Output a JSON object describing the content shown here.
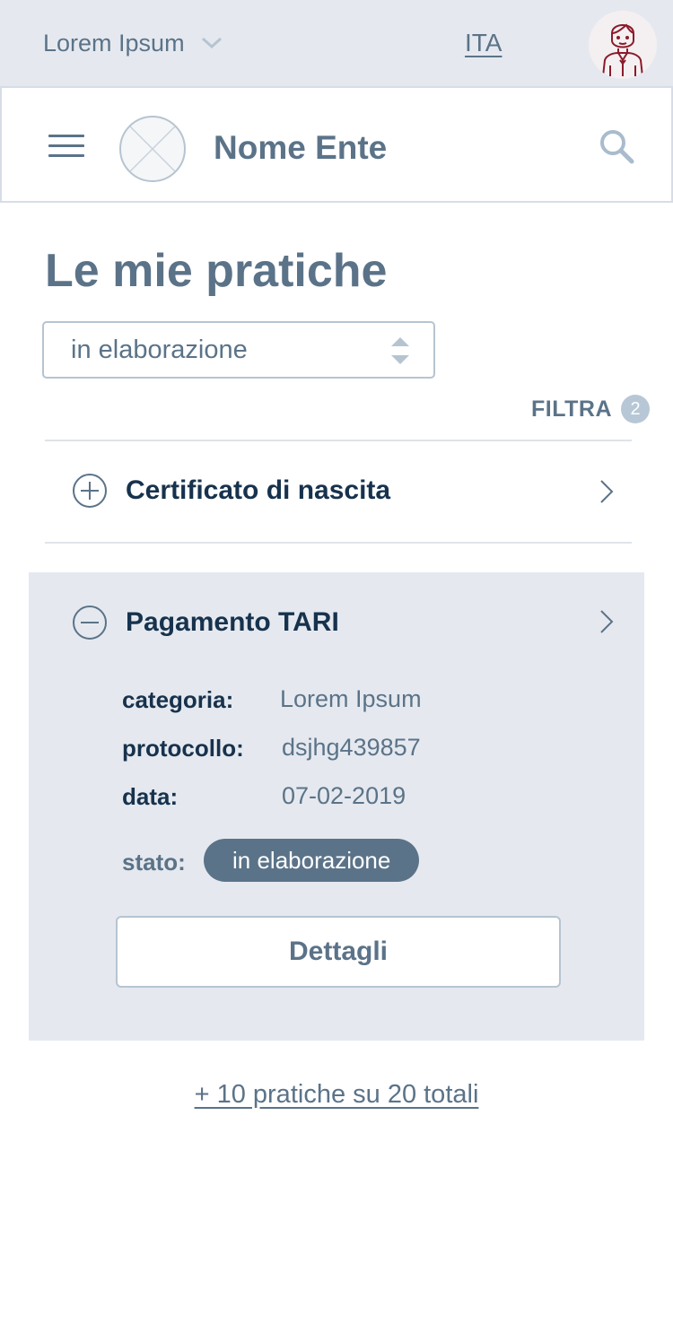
{
  "top_bar": {
    "org_label": "Lorem Ipsum",
    "language": "ITA"
  },
  "header": {
    "entity_name": "Nome Ente"
  },
  "page": {
    "title": "Le mie pratiche",
    "status_filter_value": "in elaborazione",
    "filter_label": "FILTRA",
    "filter_count": "2"
  },
  "items": [
    {
      "title": "Certificato di nascita"
    },
    {
      "title": "Pagamento TARI",
      "category_label": "categoria:",
      "category_value": "Lorem Ipsum",
      "protocol_label": "protocollo:",
      "protocol_value": "dsjhg439857",
      "date_label": "data:",
      "date_value": "07-02-2019",
      "status_label": "stato:",
      "status_value": "in elaborazione",
      "details_button": "Dettagli"
    }
  ],
  "more_link": "+ 10 pratiche su 20 totali",
  "colors": {
    "primary": "#5b7388",
    "dark_text": "#17324d",
    "band_background": "#e5e9ef",
    "avatar_red": "#8b1a2b"
  }
}
